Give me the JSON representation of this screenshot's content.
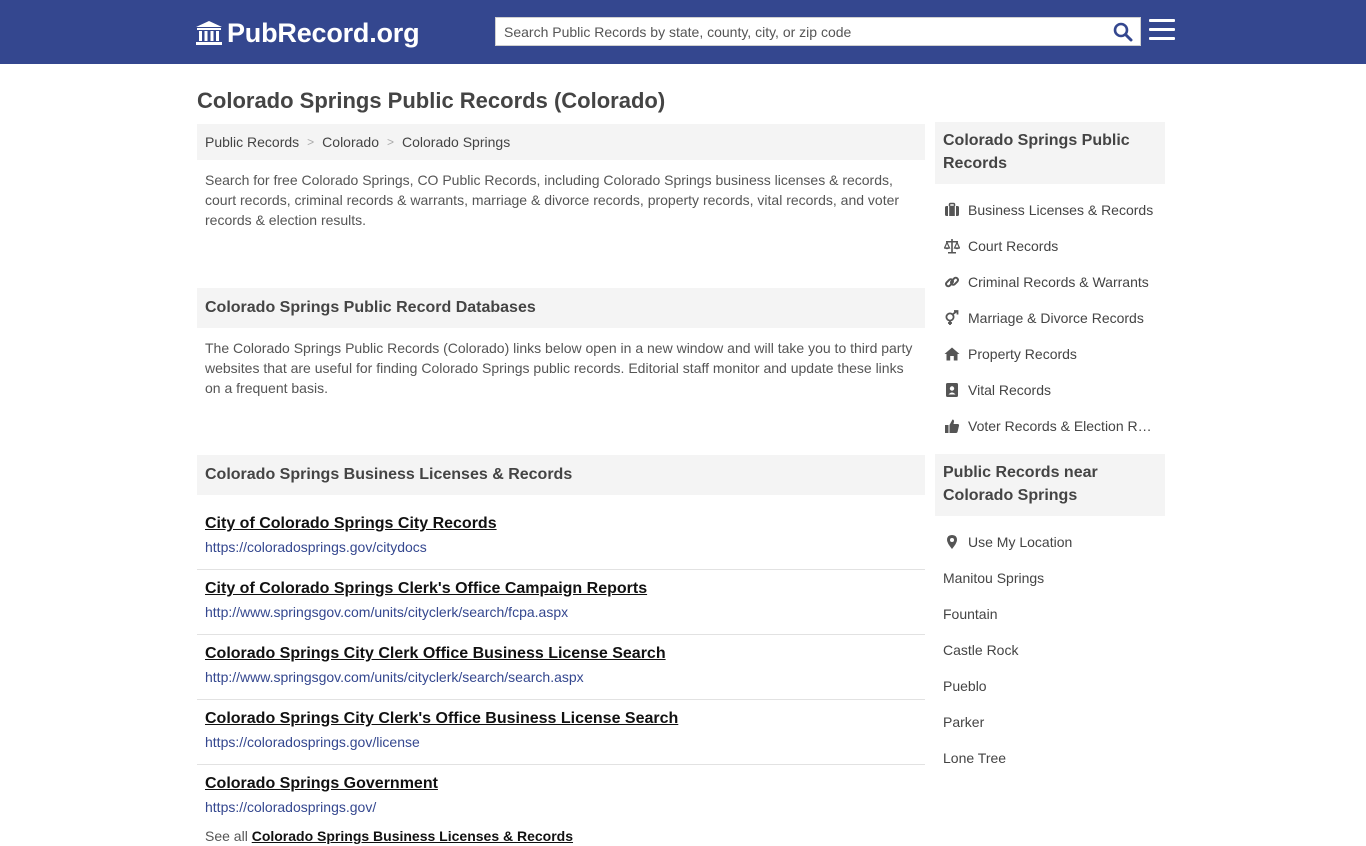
{
  "header": {
    "logo_text": "PubRecord.org",
    "search_placeholder": "Search Public Records by state, county, city, or zip code"
  },
  "page_title": "Colorado Springs Public Records (Colorado)",
  "breadcrumb": [
    "Public Records",
    "Colorado",
    "Colorado Springs"
  ],
  "intro": "Search for free Colorado Springs, CO Public Records, including Colorado Springs business licenses & records, court records, criminal records & warrants, marriage & divorce records, property records, vital records, and voter records & election results.",
  "databases": {
    "heading": "Colorado Springs Public Record Databases",
    "description": "The Colorado Springs Public Records (Colorado) links below open in a new window and will take you to third party websites that are useful for finding Colorado Springs public records. Editorial staff monitor and update these links on a frequent basis."
  },
  "business_section": {
    "heading": "Colorado Springs Business Licenses & Records",
    "links": [
      {
        "title": "City of Colorado Springs City Records",
        "url": "https://coloradosprings.gov/citydocs"
      },
      {
        "title": "City of Colorado Springs Clerk's Office Campaign Reports",
        "url": "http://www.springsgov.com/units/cityclerk/search/fcpa.aspx"
      },
      {
        "title": "Colorado Springs City Clerk Office Business License Search",
        "url": "http://www.springsgov.com/units/cityclerk/search/search.aspx"
      },
      {
        "title": "Colorado Springs City Clerk's Office Business License Search",
        "url": "https://coloradosprings.gov/license"
      },
      {
        "title": "Colorado Springs Government",
        "url": "https://coloradosprings.gov/"
      }
    ],
    "see_all_prefix": "See all",
    "see_all_link": "Colorado Springs Business Licenses & Records"
  },
  "sidebar": {
    "records_heading": "Colorado Springs Public Records",
    "records": [
      {
        "label": "Business Licenses & Records",
        "icon": "briefcase-icon"
      },
      {
        "label": "Court Records",
        "icon": "scale-icon"
      },
      {
        "label": "Criminal Records & Warrants",
        "icon": "link-icon"
      },
      {
        "label": "Marriage & Divorce Records",
        "icon": "venus-mars-icon"
      },
      {
        "label": "Property Records",
        "icon": "home-icon"
      },
      {
        "label": "Vital Records",
        "icon": "id-card-icon"
      },
      {
        "label": "Voter Records & Election Results",
        "icon": "thumbs-up-icon"
      }
    ],
    "near_heading": "Public Records near Colorado Springs",
    "use_location": "Use My Location",
    "nearby": [
      "Manitou Springs",
      "Fountain",
      "Castle Rock",
      "Pueblo",
      "Parker",
      "Lone Tree"
    ]
  },
  "colors": {
    "header_bg": "#34478f",
    "url_color": "#34478f",
    "panel_bg": "#f4f4f4"
  }
}
